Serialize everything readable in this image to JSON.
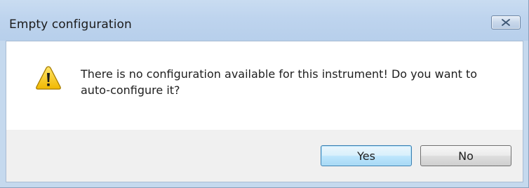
{
  "window": {
    "title": "Empty configuration",
    "close_icon": "close-icon"
  },
  "message": {
    "icon": "warning-icon",
    "text": "There is no configuration available for this instrument! Do you want to auto-configure it?"
  },
  "buttons": {
    "yes_label": "Yes",
    "no_label": "No",
    "default": "yes"
  },
  "colors": {
    "titlebar": "#bed4ee",
    "warning_yellow": "#f5c400",
    "default_button_border": "#3c7fb1"
  }
}
